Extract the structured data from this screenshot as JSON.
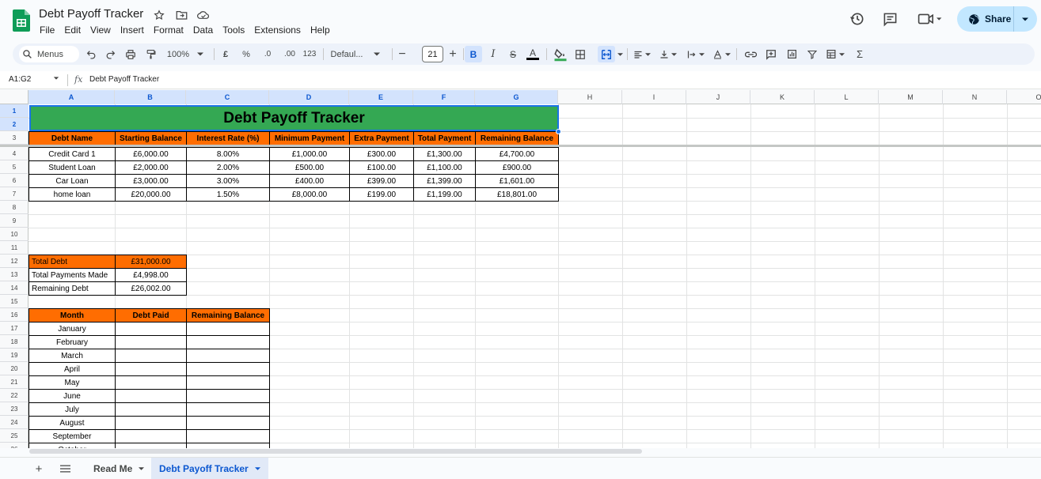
{
  "app": {
    "title": "Debt Payoff Tracker",
    "menu": [
      "File",
      "Edit",
      "View",
      "Insert",
      "Format",
      "Data",
      "Tools",
      "Extensions",
      "Help"
    ],
    "share_label": "Share"
  },
  "toolbar": {
    "menus_label": "Menus",
    "zoom": "100%",
    "currency": "£",
    "percent": "%",
    "dec_decrease": ".0",
    "dec_increase": ".00",
    "number_format": "123",
    "font": "Defaul...",
    "font_size": "21",
    "bold": "B",
    "italic": "I",
    "strike": "S",
    "text_color": "A",
    "sigma": "Σ"
  },
  "formula_bar": {
    "name_box": "A1:G2",
    "fx": "fx",
    "content": "Debt Payoff Tracker"
  },
  "grid": {
    "columns": [
      "A",
      "B",
      "C",
      "D",
      "E",
      "F",
      "G",
      "H",
      "I",
      "J",
      "K",
      "L",
      "M",
      "N",
      "O"
    ],
    "rows": [
      "1",
      "2",
      "3",
      "4",
      "5",
      "6",
      "7",
      "8",
      "9",
      "10",
      "11",
      "12",
      "13",
      "14",
      "15",
      "16",
      "17",
      "18",
      "19",
      "20",
      "21",
      "22",
      "23",
      "24",
      "25",
      "26"
    ]
  },
  "sheet": {
    "banner": "Debt Payoff Tracker",
    "debt_headers": [
      "Debt Name",
      "Starting Balance",
      "Interest Rate (%)",
      "Minimum Payment",
      "Extra Payment",
      "Total Payment",
      "Remaining Balance"
    ],
    "debts": [
      [
        "Credit Card 1",
        "£6,000.00",
        "8.00%",
        "£1,000.00",
        "£300.00",
        "£1,300.00",
        "£4,700.00"
      ],
      [
        "Student Loan",
        "£2,000.00",
        "2.00%",
        "£500.00",
        "£100.00",
        "£1,100.00",
        "£900.00"
      ],
      [
        "Car Loan",
        "£3,000.00",
        "3.00%",
        "£400.00",
        "£399.00",
        "£1,399.00",
        "£1,601.00"
      ],
      [
        "home loan",
        "£20,000.00",
        "1.50%",
        "£8,000.00",
        "£199.00",
        "£1,199.00",
        "£18,801.00"
      ]
    ],
    "summary": [
      {
        "label": "Total Debt",
        "value": "£31,000.00"
      },
      {
        "label": "Total Payments Made",
        "value": "£4,998.00"
      },
      {
        "label": "Remaining Debt",
        "value": "£26,002.00"
      }
    ],
    "month_headers": [
      "Month",
      "Debt Paid",
      "Remaining Balance"
    ],
    "months": [
      "January",
      "February",
      "March",
      "April",
      "May",
      "June",
      "July",
      "August",
      "September",
      "October"
    ]
  },
  "tabs": {
    "items": [
      {
        "label": "Read Me",
        "active": false
      },
      {
        "label": "Debt Payoff Tracker",
        "active": true
      }
    ]
  },
  "colors": {
    "banner": "#34a853",
    "header_orange": "#ff6d01",
    "share_bg": "#c2e7ff",
    "active_blue": "#0b57d0"
  }
}
